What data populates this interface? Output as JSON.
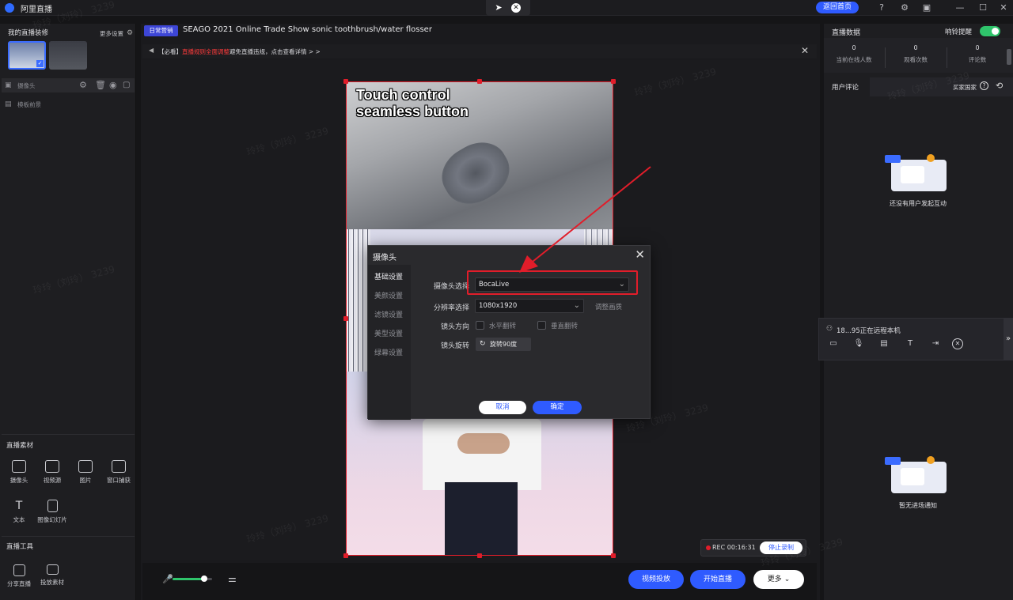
{
  "titlebar": {
    "app_name": "阿里直播",
    "home_button": "返回首页"
  },
  "left_panel": {
    "my_decor_title": "我的直播装修",
    "more_settings": "更多设置",
    "layers": [
      {
        "label": "摄像头"
      },
      {
        "label": "模板前景"
      }
    ],
    "materials_title": "直播素材",
    "materials": [
      {
        "label": "摄像头",
        "icon": "camera-icon"
      },
      {
        "label": "视频源",
        "icon": "video-source-icon"
      },
      {
        "label": "图片",
        "icon": "image-icon"
      },
      {
        "label": "窗口捕获",
        "icon": "window-capture-icon"
      },
      {
        "label": "文本",
        "icon": "text-icon"
      },
      {
        "label": "图像幻灯片",
        "icon": "slideshow-icon"
      }
    ],
    "tools_title": "直播工具",
    "tools": [
      {
        "label": "分享直播",
        "icon": "share-icon"
      },
      {
        "label": "投放素材",
        "icon": "cast-material-icon"
      }
    ]
  },
  "center": {
    "tag": "日常营销",
    "stream_title": "SEAGO 2021 Online Trade Show sonic toothbrush/water flosser",
    "notice_prefix": "【必看】",
    "notice_red": "直播规则全面调整",
    "notice_suffix": "避免直播违规，点击查看详情 > >",
    "video_slogan": "Touch control\nseamless button"
  },
  "dialog": {
    "title": "摄像头",
    "side_items": [
      "基础设置",
      "美颜设置",
      "滤镜设置",
      "美型设置",
      "绿幕设置"
    ],
    "camera_select_label": "摄像头选择",
    "camera_select_value": "BocaLive",
    "resolution_label": "分辨率选择",
    "resolution_value": "1080x1920",
    "adjust_quality": "调整画质",
    "lens_direction_label": "镜头方向",
    "flip_horizontal": "水平翻转",
    "flip_vertical": "垂直翻转",
    "lens_rotate_label": "镜头旋转",
    "rotate_button": "旋转90度",
    "cancel": "取消",
    "ok": "确定"
  },
  "bottom_bar": {
    "rec_time": "REC 00:16:31",
    "stop_record": "停止录制",
    "video_cast": "视频投放",
    "start_live": "开始直播",
    "more": "更多",
    "mic_level": 0.8
  },
  "right_panel": {
    "data_title": "直播数据",
    "ring_alert": "响铃提醒",
    "ring_alert_on": true,
    "stats": [
      {
        "value": "0",
        "label": "当前在线人数"
      },
      {
        "value": "0",
        "label": "观看次数"
      },
      {
        "value": "0",
        "label": "评论数"
      }
    ],
    "comments_tab": "用户评论",
    "buyer_country": "买家国家",
    "no_interaction": "还没有用户发起互动",
    "remote_text": "18...95正在远程本机",
    "no_entry": "暂无进场通知"
  },
  "watermark_text": "玲玲（刘玲） 3239",
  "colors": {
    "accent_blue": "#2f5bff",
    "highlight_red": "#e11d2a",
    "toggle_green": "#2fc46b"
  }
}
